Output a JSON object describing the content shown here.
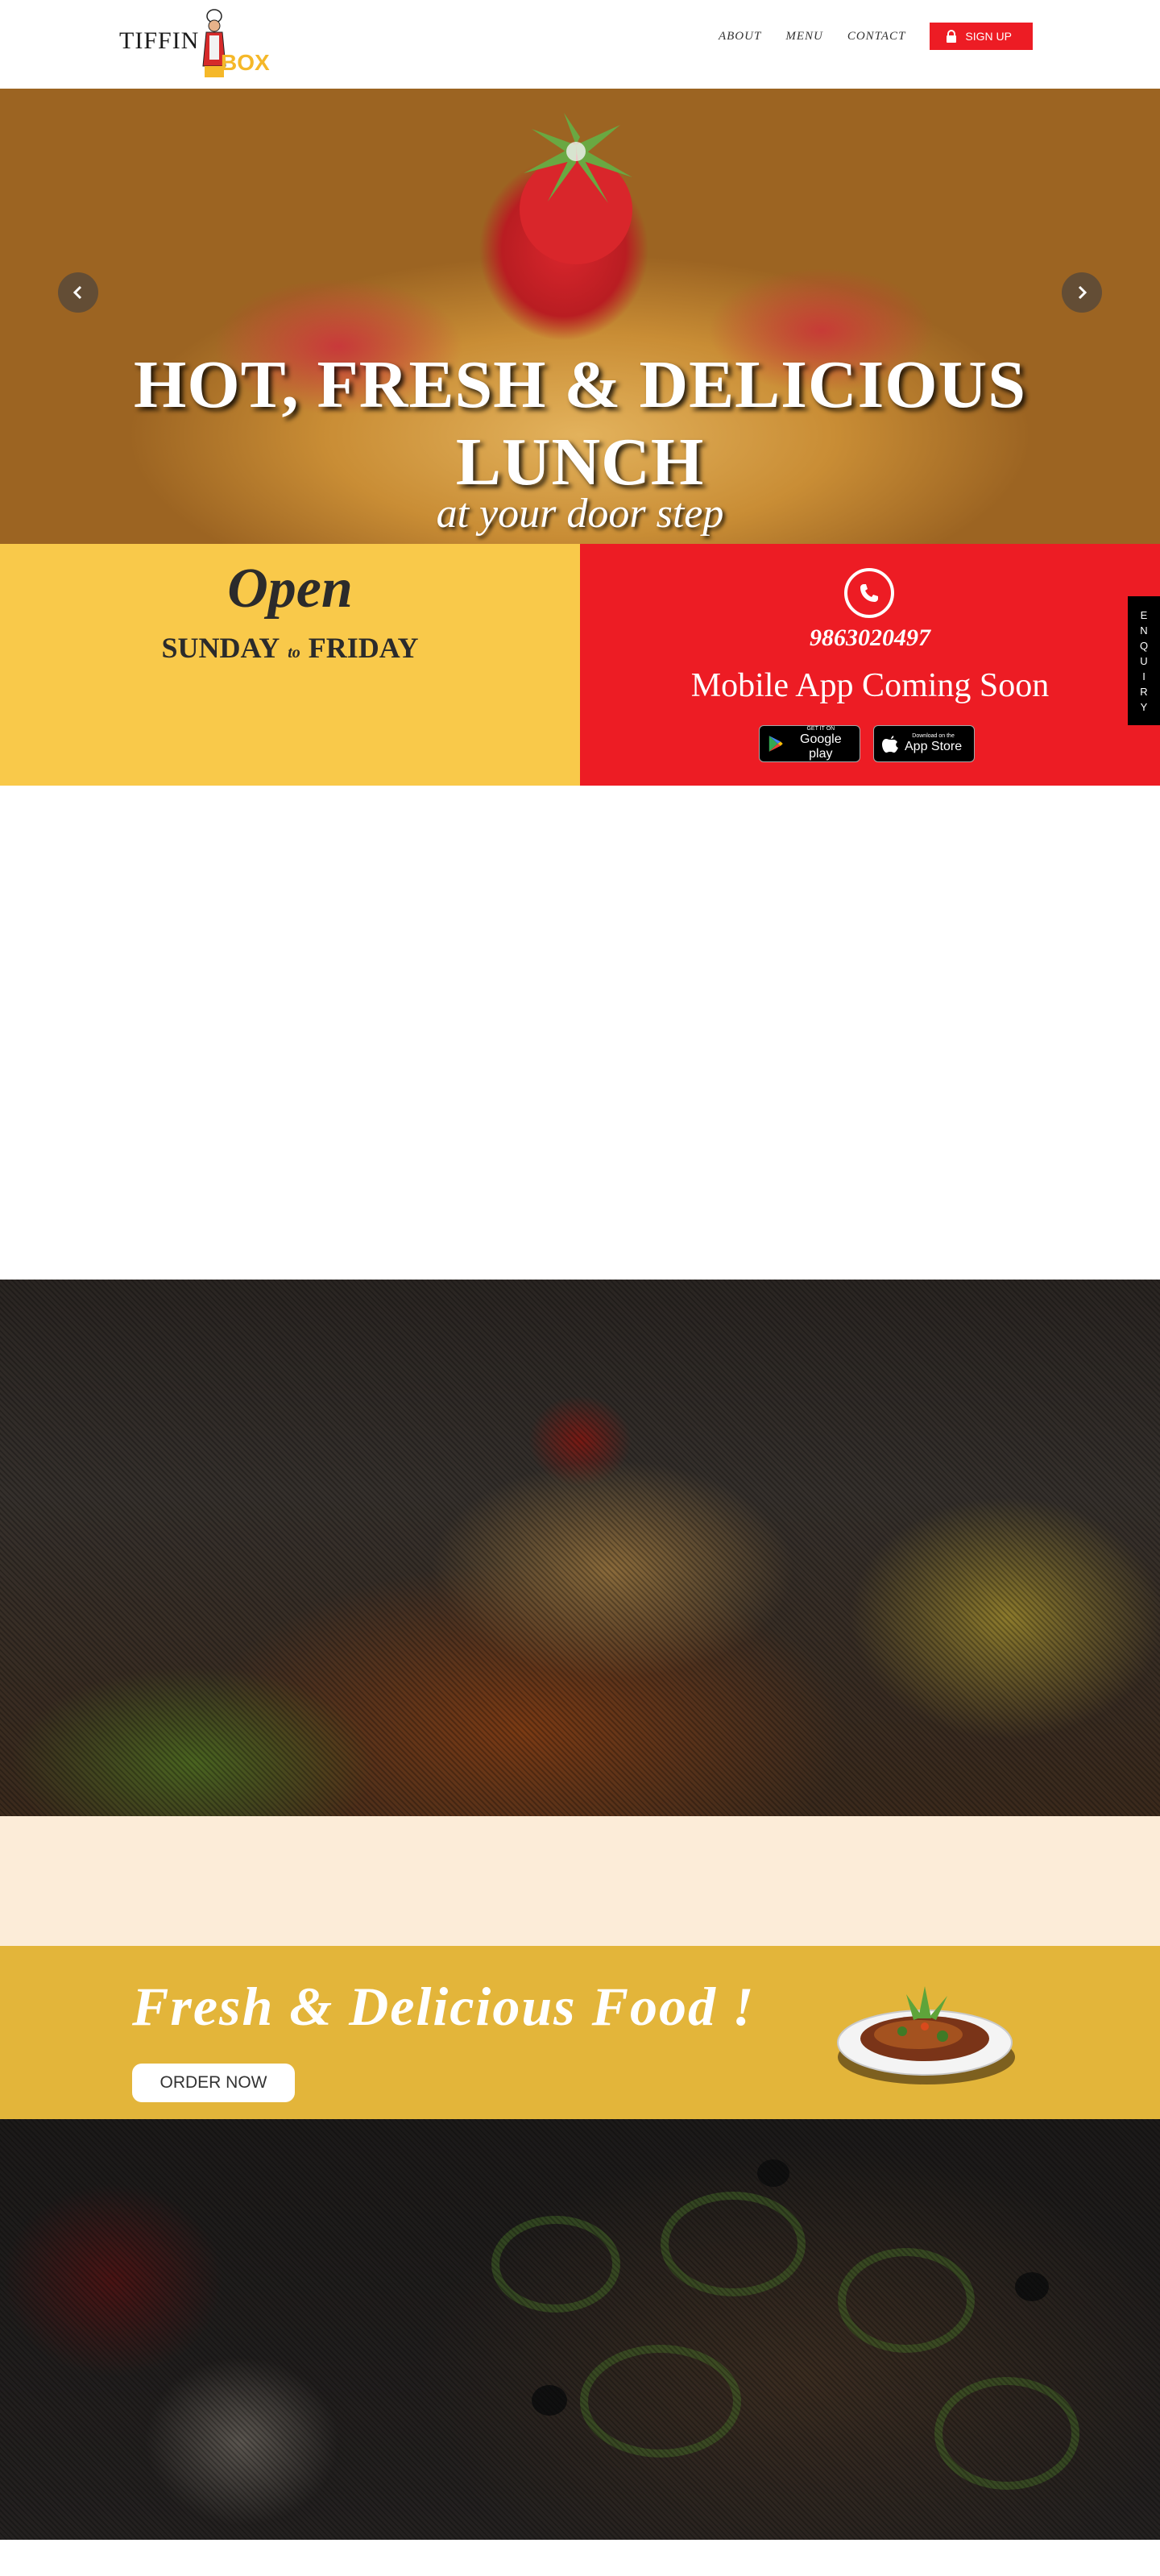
{
  "header": {
    "logo_text_main": "IFFIN",
    "logo_text_accent": "BOX",
    "nav": [
      "ABOUT",
      "MENU",
      "CONTACT"
    ],
    "signup_label": "SIGN UP"
  },
  "hero": {
    "title_line1": "HOT, FRESH & DELICIOUS",
    "title_line2": "LUNCH",
    "subtitle": "at your door step"
  },
  "hours": {
    "title": "Open",
    "day_start": "SUNDAY",
    "day_joiner": "to",
    "day_end": "FRIDAY"
  },
  "contact": {
    "phone": "9863020497",
    "app_text": "Mobile App Coming Soon",
    "google_small": "GET IT ON",
    "google_big": "Google play",
    "apple_small": "Download on the",
    "apple_big": "App Store"
  },
  "enquiry": {
    "letters": [
      "E",
      "N",
      "Q",
      "U",
      "I",
      "R",
      "Y"
    ]
  },
  "promo": {
    "title": "Fresh & Delicious Food !",
    "order_label": "ORDER NOW"
  },
  "colors": {
    "brand_red": "#ed1c24",
    "brand_yellow": "#f9c94a",
    "promo_gold": "#e3b53a",
    "cream": "#fcecd8"
  }
}
